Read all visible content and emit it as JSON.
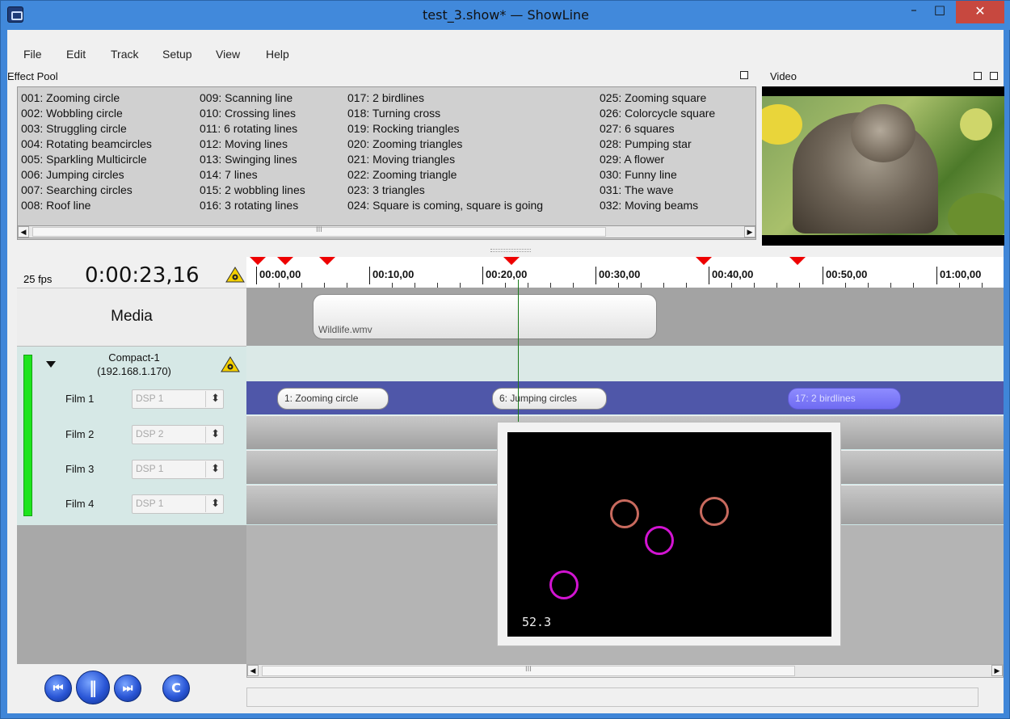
{
  "window": {
    "title": "test_3.show* — ShowLine",
    "minimize": "–",
    "maximize": "□",
    "close": "✕"
  },
  "menu": [
    "File",
    "Edit",
    "Track",
    "Setup",
    "View",
    "Help"
  ],
  "effect_pool": {
    "label": "Effect Pool",
    "columns": [
      [
        "001: Zooming circle",
        "002: Wobbling circle",
        "003: Struggling circle",
        "004: Rotating beamcircles",
        "005: Sparkling Multicircle",
        "006: Jumping circles",
        "007: Searching circles",
        "008: Roof line"
      ],
      [
        "009: Scanning line",
        "010: Crossing lines",
        "011: 6 rotating lines",
        "012: Moving lines",
        "013: Swinging lines",
        "014: 7 lines",
        "015: 2 wobbling lines",
        "016: 3 rotating lines"
      ],
      [
        "017: 2 birdlines",
        "018: Turning cross",
        "019: Rocking triangles",
        "020: Zooming triangles",
        "021: Moving triangles",
        "022: Zooming triangle",
        "023: 3 triangles",
        "024: Square is coming, square is going"
      ],
      [
        "025: Zooming square",
        "026: Colorcycle square",
        "027: 6 squares",
        "028: Pumping star",
        "029: A flower",
        "030: Funny line",
        "031: The wave",
        "032: Moving beams"
      ]
    ],
    "scroll_left": "◀",
    "scroll_right": "▶",
    "thumb_grip": "III"
  },
  "video": {
    "label": "Video"
  },
  "transport": {
    "fps": "25 fps",
    "timecode": "0:00:23,16"
  },
  "ruler": {
    "ticks": [
      "00:00,00",
      "00:10,00",
      "00:20,00",
      "00:30,00",
      "00:40,00",
      "00:50,00",
      "01:00,00"
    ],
    "marker_color": "#ee0000"
  },
  "media": {
    "label": "Media",
    "clip": "Wildlife.wmv"
  },
  "device": {
    "name": "Compact-1",
    "ip": "(192.168.1.170)",
    "status_color": "#1ee41e",
    "films": [
      {
        "label": "Film 1",
        "dsp": "DSP 1"
      },
      {
        "label": "Film 2",
        "dsp": "DSP 2"
      },
      {
        "label": "Film 3",
        "dsp": "DSP 1"
      },
      {
        "label": "Film 4",
        "dsp": "DSP 1"
      }
    ],
    "spin_arrows": "⬍"
  },
  "film1_clips": [
    "1: Zooming circle",
    "6: Jumping circles",
    "17: 2 birdlines"
  ],
  "preview": {
    "fps_readout": "52.3"
  },
  "timeline_scroll": {
    "left": "◀",
    "right": "▶",
    "grip": "III"
  },
  "transport_buttons": [
    {
      "name": "skip-back",
      "glyph": "⏮"
    },
    {
      "name": "pause",
      "glyph": "‖"
    },
    {
      "name": "skip-forward",
      "glyph": "⏭"
    },
    {
      "name": "reload",
      "glyph": "C"
    }
  ],
  "accent": {
    "track_blue": "#4f57a9",
    "playhead": "#1a7a1a"
  }
}
